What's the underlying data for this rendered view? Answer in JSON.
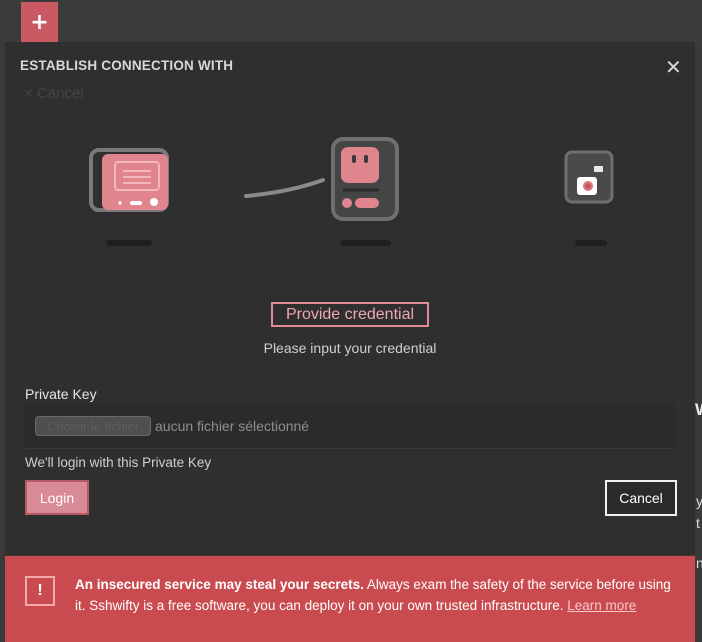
{
  "top": {
    "add_tab_label": "+"
  },
  "dialog": {
    "title": "ESTABLISH CONNECTION WITH",
    "close_label": "✕",
    "ghost_cancel": "× Cancel"
  },
  "step": {
    "title": "Provide credential",
    "subtitle": "Please input your credential"
  },
  "form": {
    "private_key_label": "Private Key",
    "file_button": "Choisir le fichier",
    "file_status": "aucun fichier sélectionné",
    "help_text": "We'll login with this Private Key",
    "login_label": "Login",
    "cancel_label": "Cancel"
  },
  "warning": {
    "icon": "!",
    "bold_text": "An insecured service may steal your secrets.",
    "text": " Always exam the safety of the service before using it. Sshwifty is a free software, you can deploy it on your own trusted infrastructure. ",
    "link_text": "Learn more"
  },
  "colors": {
    "accent": "#c95a63",
    "dialog_bg": "#2f2f2f",
    "warning_bg": "#c94b4f"
  }
}
